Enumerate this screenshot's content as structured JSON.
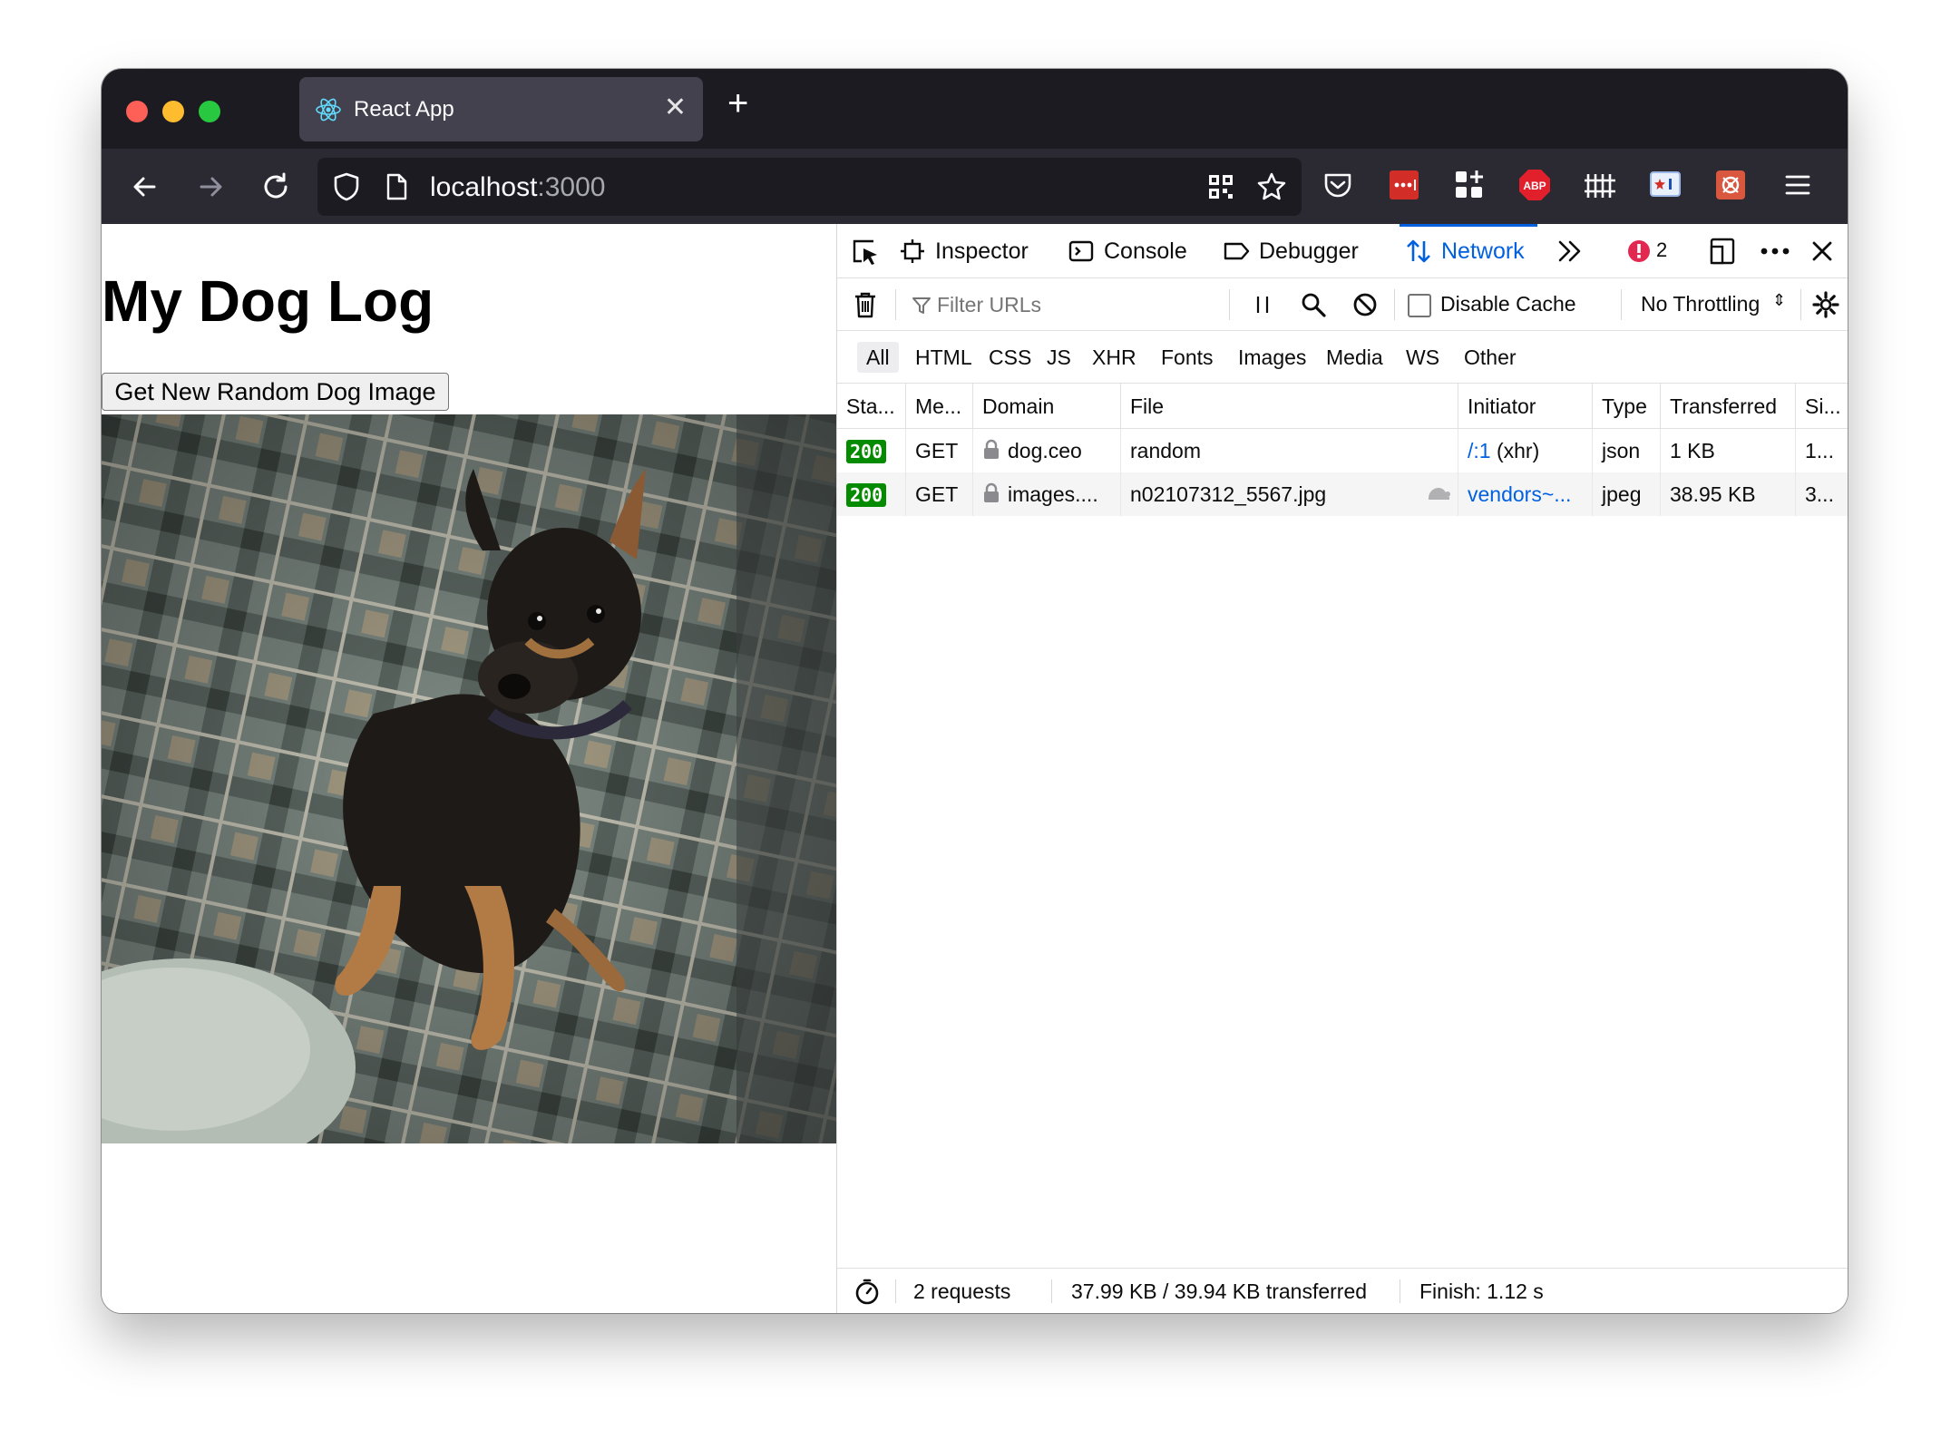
{
  "browser": {
    "tab_title": "React App",
    "url_host": "localhost",
    "url_port": ":3000"
  },
  "page": {
    "heading": "My Dog Log",
    "button_label": "Get New Random Dog Image"
  },
  "devtools": {
    "tabs": {
      "inspector": "Inspector",
      "console": "Console",
      "debugger": "Debugger",
      "network": "Network"
    },
    "error_count": "2",
    "filter_placeholder": "Filter URLs",
    "disable_cache_label": "Disable Cache",
    "throttling": "No Throttling",
    "type_filters": [
      "All",
      "HTML",
      "CSS",
      "JS",
      "XHR",
      "Fonts",
      "Images",
      "Media",
      "WS",
      "Other"
    ],
    "columns": [
      "Sta...",
      "Me...",
      "Domain",
      "File",
      "Initiator",
      "Type",
      "Transferred",
      "Si..."
    ],
    "rows": [
      {
        "status": "200",
        "method": "GET",
        "domain": "dog.ceo",
        "file": "random",
        "initiator_link": "/:1",
        "initiator_suffix": " (xhr)",
        "type": "json",
        "transferred": "1 KB",
        "size": "1..."
      },
      {
        "status": "200",
        "method": "GET",
        "domain": "images....",
        "file": "n02107312_5567.jpg",
        "initiator_link": "vendors~...",
        "initiator_suffix": "",
        "type": "jpeg",
        "transferred": "38.95 KB",
        "size": "3..."
      }
    ],
    "statusbar": {
      "requests": "2 requests",
      "transferred": "37.99 KB / 39.94 KB transferred",
      "finish": "Finish: 1.12 s"
    }
  }
}
